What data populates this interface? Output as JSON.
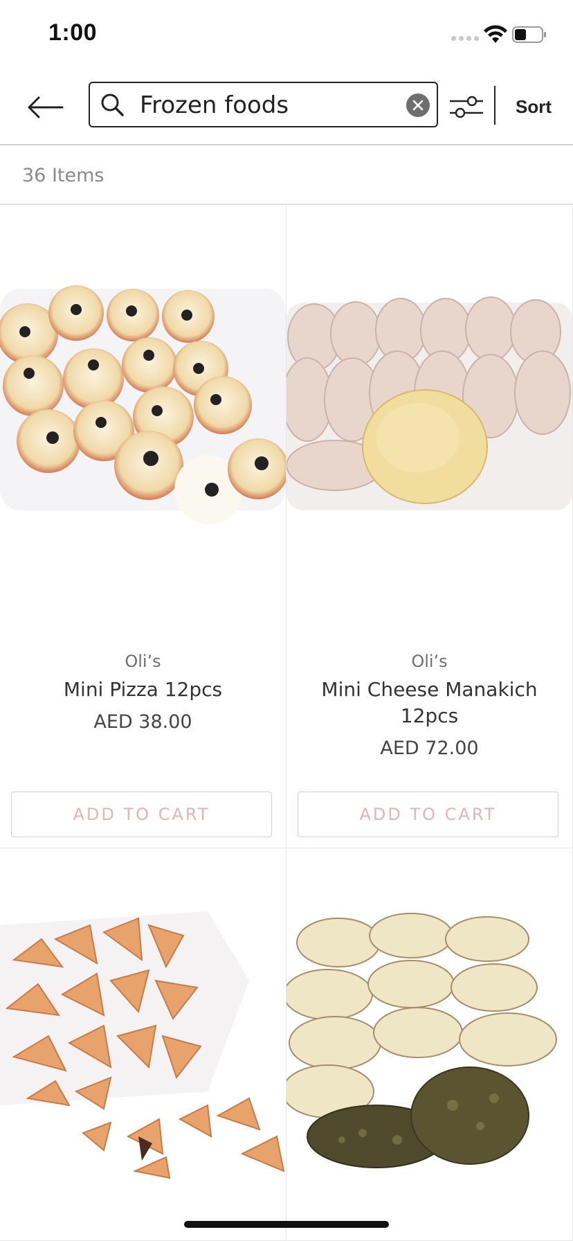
{
  "status": {
    "time": "1:00"
  },
  "search": {
    "value": "Frozen foods",
    "placeholder": ""
  },
  "toolbar": {
    "sort_label": "Sort"
  },
  "results": {
    "count_label": "36 Items"
  },
  "products": [
    {
      "brand": "Oli’s",
      "name": "Mini Pizza 12pcs",
      "price": "AED 38.00",
      "cart_label": "ADD TO CART",
      "image": "mini-pizza-photo"
    },
    {
      "brand": "Oli’s",
      "name": "Mini Cheese Manakich 12pcs",
      "price": "AED 72.00",
      "cart_label": "ADD TO CART",
      "image": "cheese-manakich-photo"
    },
    {
      "image": "fatayer-photo"
    },
    {
      "image": "zaatar-manakich-photo"
    }
  ],
  "colors": {
    "cart_border": "#e7c8c8",
    "cart_text": "#e2b4b4",
    "accent": "#222222"
  }
}
